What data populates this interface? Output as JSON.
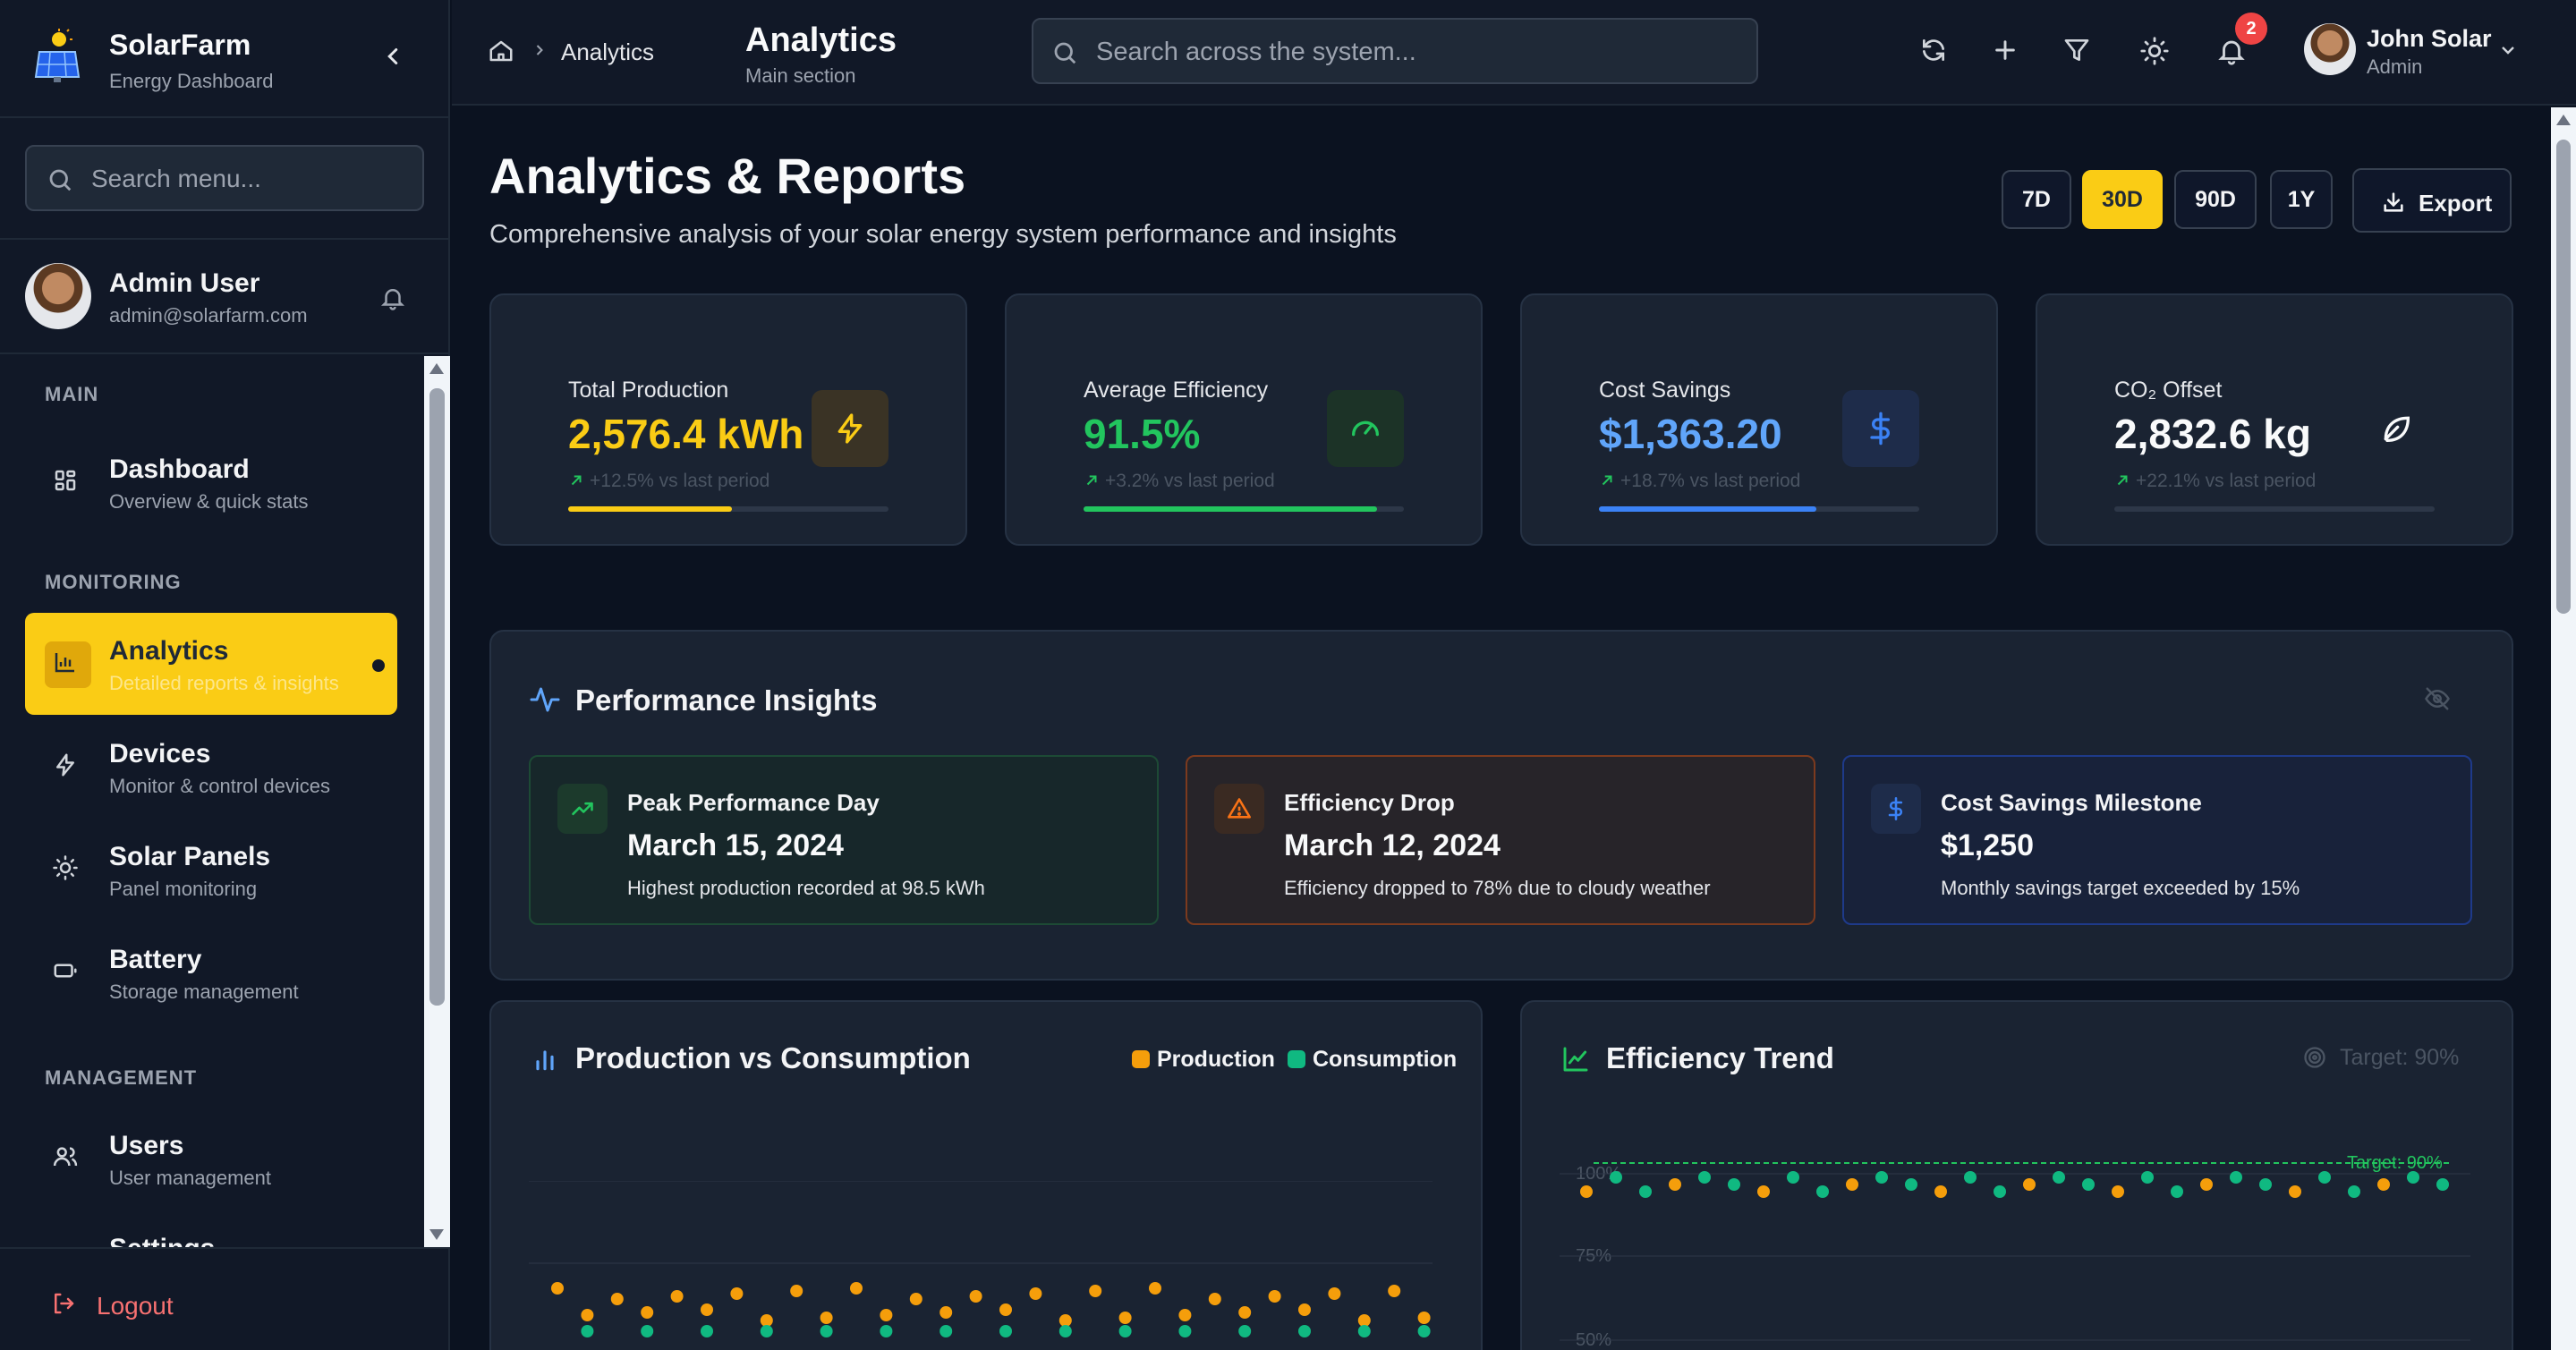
{
  "brand": {
    "title": "SolarFarm",
    "subtitle": "Energy Dashboard"
  },
  "sidebar": {
    "search_placeholder": "Search menu...",
    "user": {
      "name": "Admin User",
      "email": "admin@solarfarm.com"
    },
    "sections": {
      "main": "MAIN",
      "monitoring": "MONITORING",
      "management": "MANAGEMENT"
    },
    "items": [
      {
        "label": "Dashboard",
        "sub": "Overview & quick stats",
        "icon": "grid-icon"
      },
      {
        "label": "Analytics",
        "sub": "Detailed reports & insights",
        "icon": "bar-chart-icon",
        "active": true
      },
      {
        "label": "Devices",
        "sub": "Monitor & control devices",
        "icon": "bolt-icon"
      },
      {
        "label": "Solar Panels",
        "sub": "Panel monitoring",
        "icon": "sun-icon"
      },
      {
        "label": "Battery",
        "sub": "Storage management",
        "icon": "battery-icon"
      },
      {
        "label": "Users",
        "sub": "User management",
        "icon": "users-icon"
      },
      {
        "label": "Settings",
        "sub": "",
        "icon": "gear-icon"
      }
    ],
    "logout_label": "Logout"
  },
  "header": {
    "breadcrumb": "Analytics",
    "title": "Analytics",
    "subtitle": "Main section",
    "search_placeholder": "Search across the system...",
    "notifications_count": "2",
    "user": {
      "name": "John Solar",
      "role": "Admin"
    }
  },
  "page": {
    "title": "Analytics & Reports",
    "subtitle": "Comprehensive analysis of your solar energy system performance and insights",
    "ranges": [
      "7D",
      "30D",
      "90D",
      "1Y"
    ],
    "active_range": "30D",
    "export_label": "Export"
  },
  "stats": [
    {
      "label": "Total Production",
      "value": "2,576.4 kWh",
      "change": "+12.5% vs last period",
      "progress": 0.51,
      "color": "#facc15",
      "icon": "bolt-icon"
    },
    {
      "label": "Average Efficiency",
      "value": "91.5%",
      "change": "+3.2% vs last period",
      "progress": 0.915,
      "color": "#22c55e",
      "icon": "gauge-icon"
    },
    {
      "label": "Cost Savings",
      "value": "$1,363.20",
      "change": "+18.7% vs last period",
      "progress": 0.68,
      "color": "#3b82f6",
      "icon": "dollar-icon"
    },
    {
      "label": "CO₂ Offset",
      "value": "2,832.6 kg",
      "change": "+22.1% vs last period",
      "progress": 0,
      "color": "#f9fafb",
      "icon": "leaf-icon"
    }
  ],
  "insights": {
    "title": "Performance Insights",
    "cards": [
      {
        "title": "Peak Performance Day",
        "value": "March 15, 2024",
        "desc": "Highest production recorded at 98.5 kWh",
        "icon": "trend-up-icon"
      },
      {
        "title": "Efficiency Drop",
        "value": "March 12, 2024",
        "desc": "Efficiency dropped to 78% due to cloudy weather",
        "icon": "warning-icon"
      },
      {
        "title": "Cost Savings Milestone",
        "value": "$1,250",
        "desc": "Monthly savings target exceeded by 15%",
        "icon": "dollar-icon"
      }
    ]
  },
  "charts": {
    "production": {
      "title": "Production vs Consumption",
      "legend": [
        "Production",
        "Consumption"
      ],
      "colors": [
        "#f59e0b",
        "#10b981"
      ]
    },
    "efficiency": {
      "title": "Efficiency Trend",
      "target_label": "Target: 90%",
      "target_line_label": "Target: 90%",
      "ticks": [
        "100%",
        "75%",
        "50%"
      ]
    }
  }
}
